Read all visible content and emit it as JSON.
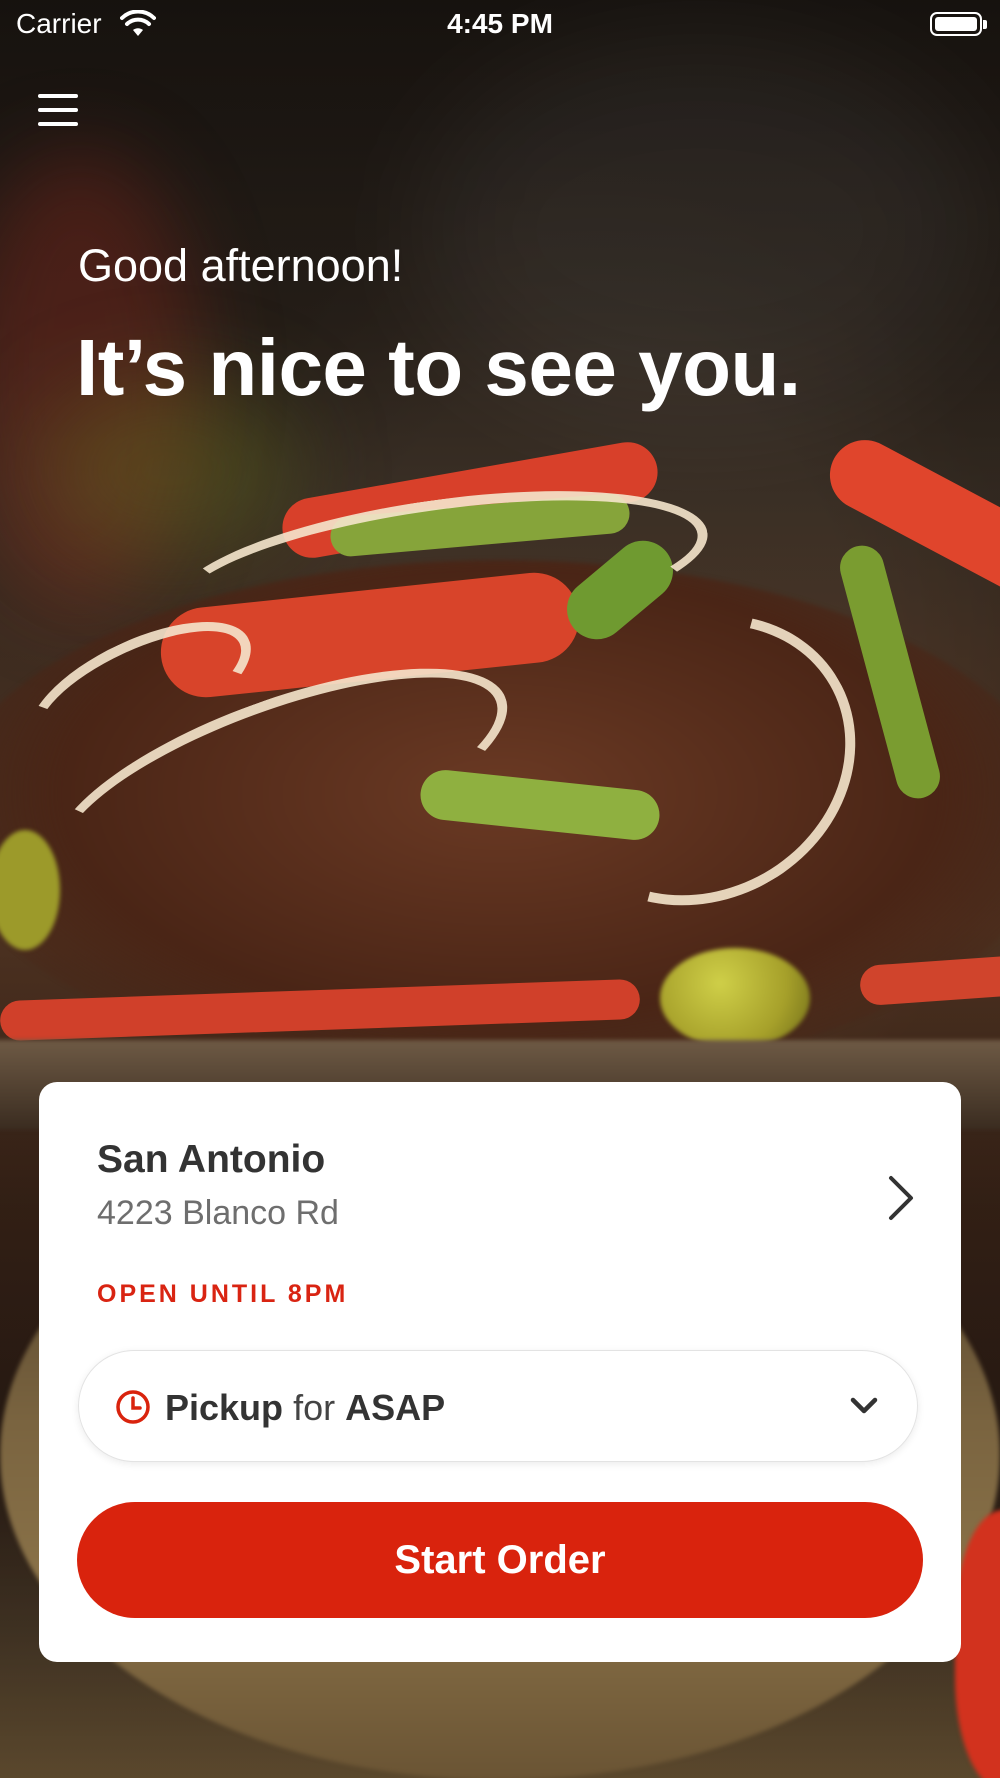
{
  "status_bar": {
    "carrier": "Carrier",
    "time": "4:45 PM"
  },
  "greeting": "Good afternoon!",
  "headline": "It’s nice to see you.",
  "location": {
    "name": "San Antonio",
    "address": "4223 Blanco Rd",
    "hours_status": "OPEN UNTIL 8PM"
  },
  "order_type": {
    "mode": "Pickup",
    "connector": "for",
    "time": "ASAP"
  },
  "start_order_label": "Start Order",
  "colors": {
    "accent": "#d9230d",
    "card_bg": "#ffffff",
    "text_dark": "#333333"
  },
  "icons": [
    "menu-icon",
    "wifi-icon",
    "battery-icon",
    "chevron-right-icon",
    "clock-icon",
    "chevron-down-icon"
  ]
}
